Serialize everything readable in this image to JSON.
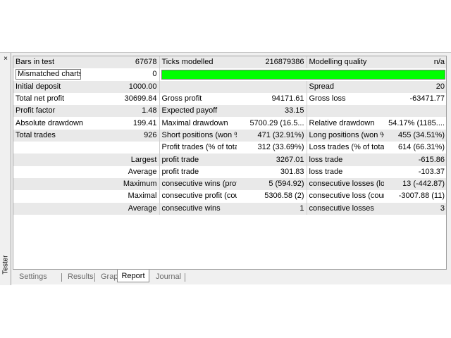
{
  "window": {
    "close_label": "×",
    "side_label": "Tester"
  },
  "report": {
    "rows": [
      [
        "Bars in test",
        "67678",
        "Ticks modelled",
        "216879386",
        "Modelling quality",
        "n/a"
      ],
      [
        "Mismatched charts...",
        "0",
        "",
        "",
        "",
        ""
      ],
      [
        "Initial deposit",
        "1000.00",
        "",
        "",
        "Spread",
        "20"
      ],
      [
        "Total net profit",
        "30699.84",
        "Gross profit",
        "94171.61",
        "Gross loss",
        "-63471.77"
      ],
      [
        "Profit factor",
        "1.48",
        "Expected payoff",
        "33.15",
        "",
        ""
      ],
      [
        "Absolute drawdown",
        "199.41",
        "Maximal drawdown",
        "5700.29 (16.5...",
        "Relative drawdown",
        "54.17% (1185...."
      ],
      [
        "Total trades",
        "926",
        "Short positions (won %)",
        "471 (32.91%)",
        "Long positions (won %)",
        "455 (34.51%)"
      ],
      [
        "",
        "",
        "Profit trades (% of total)",
        "312 (33.69%)",
        "Loss trades (% of total)",
        "614 (66.31%)"
      ],
      [
        "",
        "Largest",
        "profit trade",
        "3267.01",
        "loss trade",
        "-615.86"
      ],
      [
        "",
        "Average",
        "profit trade",
        "301.83",
        "loss trade",
        "-103.37"
      ],
      [
        "",
        "Maximum",
        "consecutive wins (profi...",
        "5 (594.92)",
        "consecutive losses (loss...",
        "13 (-442.87)"
      ],
      [
        "",
        "Maximal",
        "consecutive profit (cou...",
        "5306.58 (2)",
        "consecutive loss (count...",
        "-3007.88 (11)"
      ],
      [
        "",
        "Average",
        "consecutive wins",
        "1",
        "consecutive losses",
        "3"
      ]
    ],
    "modelling_quality_fill": 1.0,
    "bar_color": "#00ff00"
  },
  "tabs": [
    {
      "label": "Settings",
      "active": false
    },
    {
      "label": "Results",
      "active": false
    },
    {
      "label": "Graph",
      "active": false
    },
    {
      "label": "Report",
      "active": true
    },
    {
      "label": "Journal",
      "active": false
    }
  ]
}
